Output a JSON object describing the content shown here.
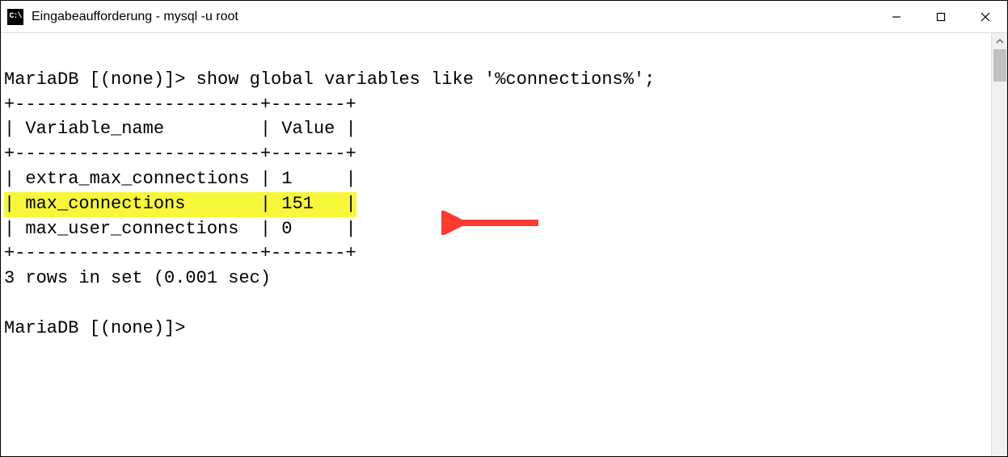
{
  "window": {
    "icon_text": "C:\\",
    "title": "Eingabeaufforderung - mysql  -u root"
  },
  "terminal": {
    "prompt1": "MariaDB [(none)]> ",
    "command": "show global variables like '%connections%';",
    "border_top": "+-----------------------+-------+",
    "header_line": "| Variable_name         | Value |",
    "border_mid": "+-----------------------+-------+",
    "row1": "| extra_max_connections | 1     |",
    "row2_highlighted": "| max_connections       | 151   |",
    "row3": "| max_user_connections  | 0     |",
    "border_bot": "+-----------------------+-------+",
    "summary": "3 rows in set (0.001 sec)",
    "prompt2": "MariaDB [(none)]> "
  }
}
